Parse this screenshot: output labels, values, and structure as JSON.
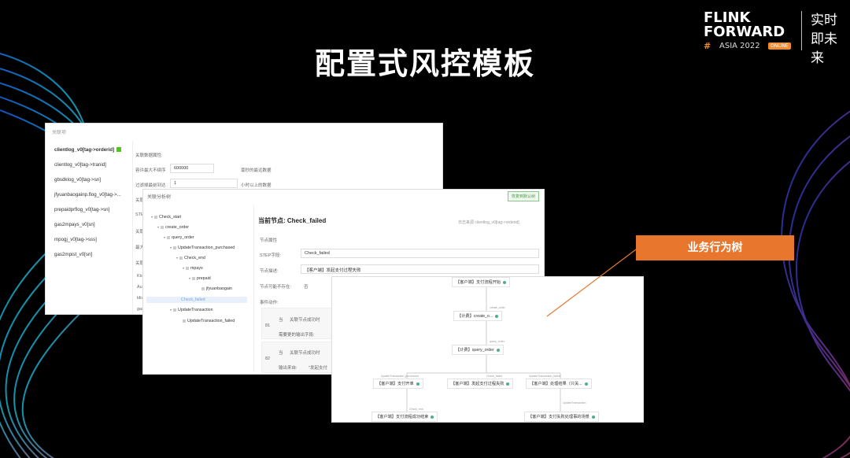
{
  "slide": {
    "title": "配置式风控模板"
  },
  "logo": {
    "line1": "FLINK",
    "line2": "FORWARD",
    "hash": "#",
    "asia": "ASIA 2022",
    "online": "ONLINE",
    "cn": "实时即未来"
  },
  "panel1": {
    "header": "关联项",
    "sidebar": [
      "clientlog_v0[tag->orderid]",
      "clientlog_v0[tag->tranid]",
      "gbsdklog_v0[tag->sn]",
      "jfyuanbaogainp.flog_v0[tag->...",
      "prepaidprflog_v0[tag->sn]",
      "gas2mpays_v0[sn]",
      "mpogj_v0[tag->sss]",
      "gas2mpist_v0[sn]"
    ],
    "form": {
      "title": "关联数据属性:",
      "r1_label": "容许最大不续序",
      "r1_value": "600000",
      "r1_hint": "毫秒的最远数据",
      "r2_label": "过滤掉最前到达",
      "r2_value": "1",
      "r2_hint": "小时以上的数据",
      "r3_label": "关联",
      "r4_label": "STE",
      "r5_label": "关联",
      "r6_label": "最大",
      "r7_label": "关联",
      "r8_label": "Klo",
      "r9_label": "Aub",
      "r10_label": "ldiu",
      "r11_label": "gas"
    }
  },
  "panel2": {
    "header": "关联分析树",
    "top_button": "恢复到默认树",
    "tree": [
      "Check_start",
      "create_order",
      "query_order",
      "UpdateTransaction_purchased",
      "Check_end",
      "mpays",
      "prepaid",
      "jfyuanbaogain",
      "Check_failed",
      "UpdateTransaction",
      "UpdateTransaction_failed"
    ],
    "current_label": "当前节点: Check_failed",
    "current_right": "日志来源  clientlog_v0[tag->orderid]",
    "node_props": "节点属性",
    "step_label": "STEP字段:",
    "step_value": "Check_failed",
    "desc_label": "节点描述:",
    "desc_value": "【客户端】发起支付过程失败",
    "timeout_label": "节点可能不存在:",
    "timeout_value": "否",
    "event_label": "事件动作:",
    "sub1_a": "当",
    "sub1_b": "关联节点成功时",
    "sub1_c": "需要更的输出字段:",
    "sub1_num": "81",
    "sub2_a": "当",
    "sub2_b": "关联节点成功时",
    "sub2_c": "输出来自:",
    "sub2_d": "\"发起支付",
    "sub2_num": "82"
  },
  "panel3": {
    "nodes": {
      "n1": "【客户端】支付流程开始",
      "n2": "【计费】create_o...",
      "n3": "【计费】query_order",
      "n4": "【客户端】支付开单",
      "n5": "【客户端】发起支付过程失败",
      "n6": "【客户端】处理结果（只关...",
      "n7": "【客户端】支付流程成功结束",
      "n8": "【客户端】支付失败处理事的场景"
    },
    "edge_labels": [
      "create_order",
      "query_order",
      "UpdateTransaction_purchased",
      "Check_failed",
      "UpdateTransaction_failed",
      "Check_end",
      "UpdateTransaction"
    ]
  },
  "callout": {
    "text": "业务行为树"
  },
  "colors": {
    "accent": "#e8772d",
    "badge": "#52c41a",
    "node_ok": "#4caf8a"
  }
}
